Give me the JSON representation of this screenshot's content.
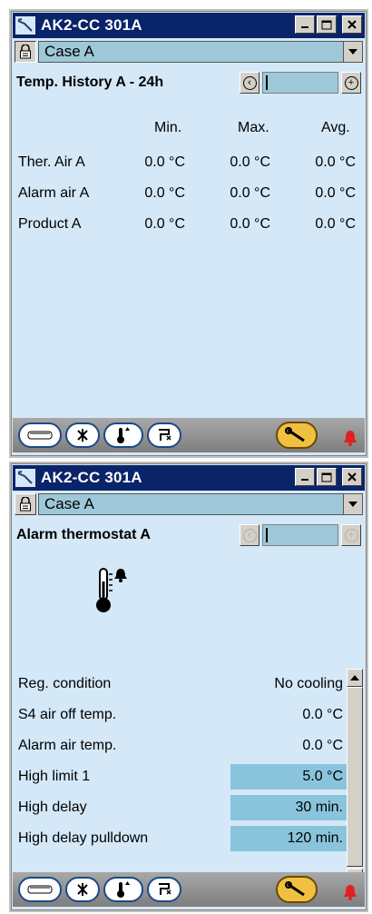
{
  "window1": {
    "title": "AK2-CC 301A",
    "case_select": "Case A",
    "header": "Temp. History A - 24h",
    "columns": [
      "Min.",
      "Max.",
      "Avg."
    ],
    "rows": [
      {
        "label": "Ther. Air A",
        "min": "0.0 °C",
        "max": "0.0 °C",
        "avg": "0.0 °C"
      },
      {
        "label": "Alarm air A",
        "min": "0.0 °C",
        "max": "0.0 °C",
        "avg": "0.0 °C"
      },
      {
        "label": "Product A",
        "min": "0.0 °C",
        "max": "0.0 °C",
        "avg": "0.0 °C"
      }
    ]
  },
  "window2": {
    "title": "AK2-CC 301A",
    "case_select": "Case A",
    "header": "Alarm thermostat A",
    "params": [
      {
        "label": "Reg. condition",
        "value": "No cooling",
        "editable": false
      },
      {
        "label": "S4 air off temp.",
        "value": "0.0 °C",
        "editable": false
      },
      {
        "label": "Alarm air temp.",
        "value": "0.0 °C",
        "editable": false
      },
      {
        "label": "High limit 1",
        "value": "5.0 °C",
        "editable": true
      },
      {
        "label": "High delay",
        "value": "30 min.",
        "editable": true
      },
      {
        "label": "High delay pulldown",
        "value": "120 min.",
        "editable": true
      }
    ]
  },
  "colors": {
    "title_bar": "#0a246a",
    "panel_bg": "#d4e8f8",
    "field_bg": "#9ec8d8",
    "editable_bg": "#8ac4dc",
    "alarm_red": "#e02020",
    "wrench_gold": "#f0c040"
  },
  "icons": [
    "app-icon",
    "lock-icon",
    "dropdown-arrow-icon",
    "nav-prev-icon",
    "nav-next-icon",
    "case-icon",
    "fan-icon",
    "thermometer-icon",
    "defrost-icon",
    "wrench-icon",
    "alarm-bell-icon"
  ]
}
